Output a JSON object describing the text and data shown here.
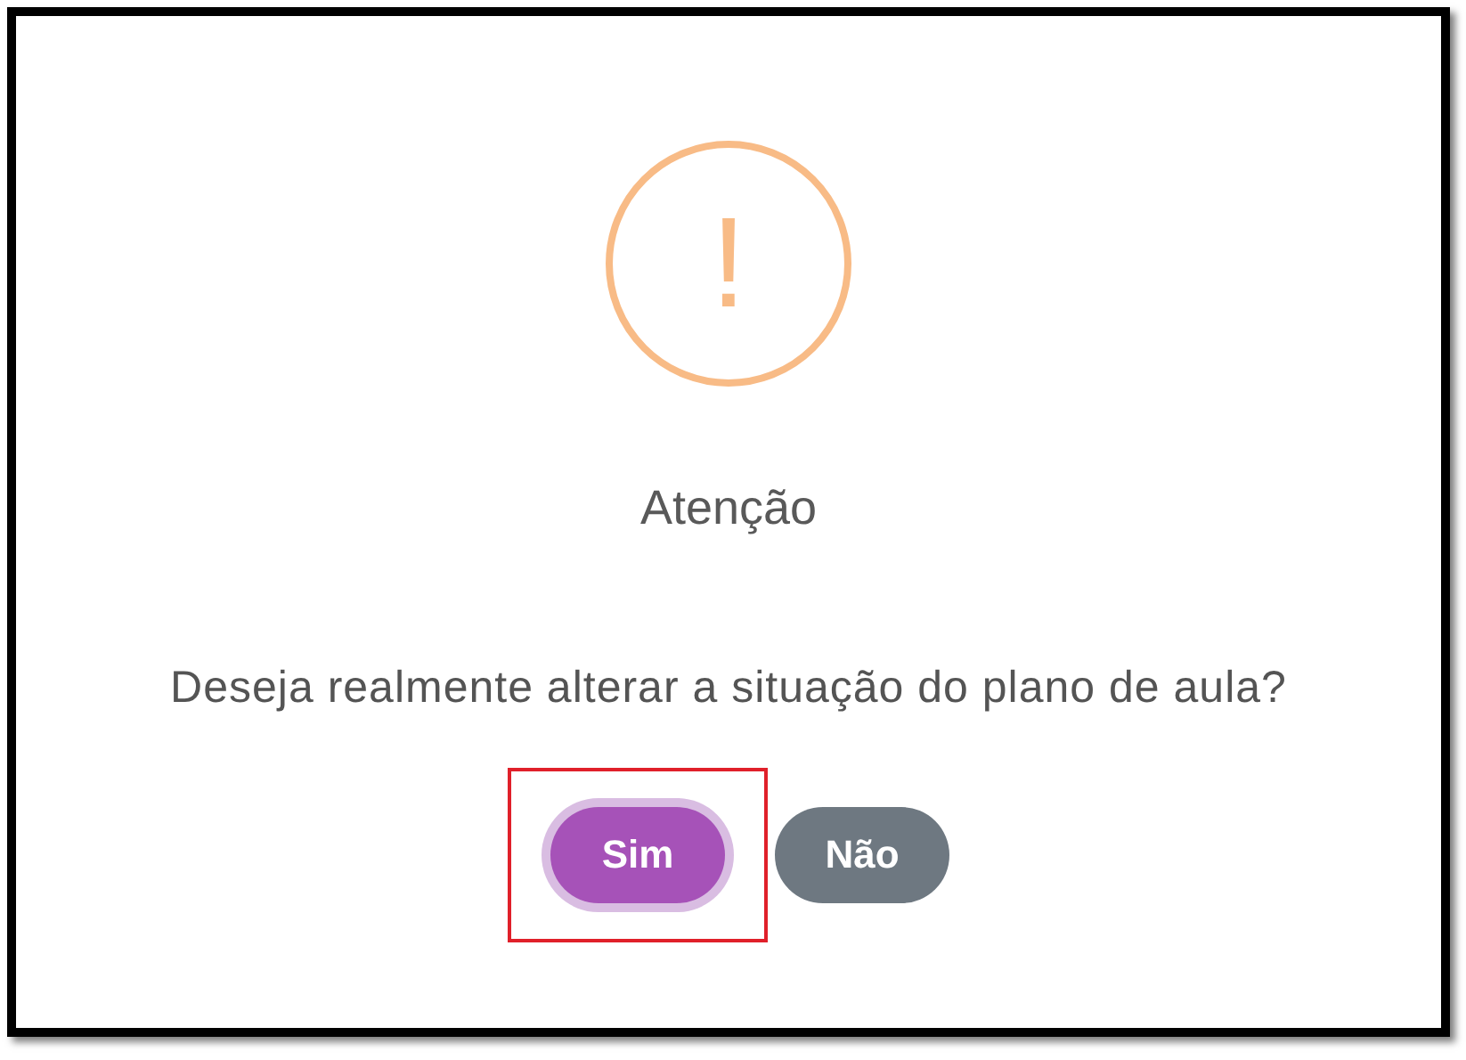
{
  "dialog": {
    "title": "Atenção",
    "message": "Deseja realmente alterar a situação do plano de aula?",
    "icon_text": "!",
    "buttons": [
      {
        "label": "Sim",
        "kind": "confirm",
        "focused": true,
        "highlighted": true
      },
      {
        "label": "Não",
        "kind": "cancel",
        "focused": false,
        "highlighted": false
      }
    ]
  }
}
